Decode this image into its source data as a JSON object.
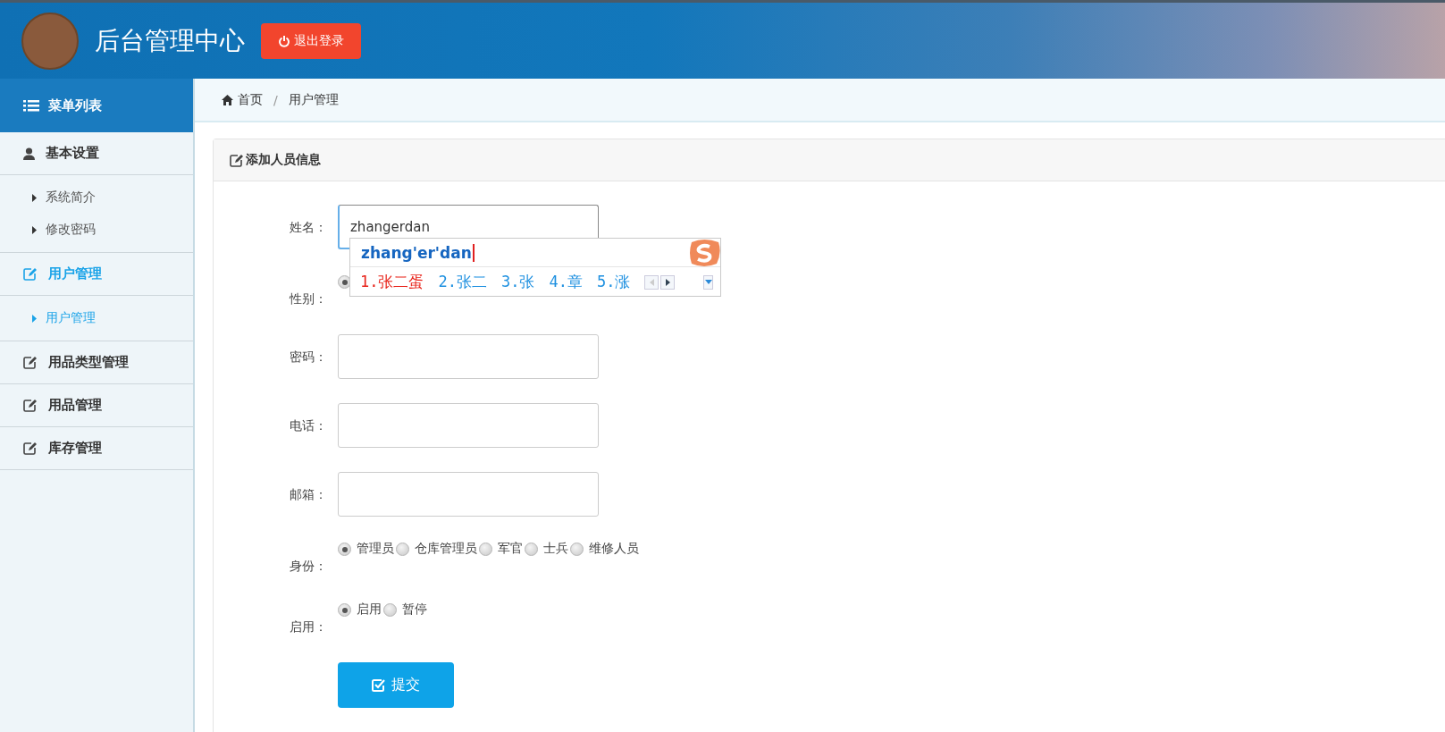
{
  "header": {
    "title": "后台管理中心",
    "logout_button": "退出登录"
  },
  "sidebar": {
    "title": "菜单列表",
    "groups": [
      {
        "label": "基本设置",
        "kind": "user",
        "selected": false,
        "items": [
          {
            "label": "系统简介",
            "selected": false
          },
          {
            "label": "修改密码",
            "selected": false
          }
        ]
      },
      {
        "label": "用户管理",
        "kind": "edit",
        "selected": true,
        "items": [
          {
            "label": "用户管理",
            "selected": true
          }
        ]
      },
      {
        "label": "用品类型管理",
        "kind": "edit",
        "selected": false
      },
      {
        "label": "用品管理",
        "kind": "edit",
        "selected": false
      },
      {
        "label": "库存管理",
        "kind": "edit",
        "selected": false
      }
    ]
  },
  "breadcrumb": {
    "separator": "/",
    "items": [
      {
        "label": "首页",
        "kind": "home"
      },
      {
        "label": "用户管理",
        "kind": "page"
      }
    ]
  },
  "form": {
    "title": "添加人员信息",
    "fields": [
      {
        "kind": "text",
        "label": "姓名：",
        "value": "zhangerdan"
      },
      {
        "kind": "radio",
        "label": "性别：",
        "options": [
          {
            "selected": true
          }
        ]
      },
      {
        "kind": "text",
        "label": "密码："
      },
      {
        "kind": "text",
        "label": "电话："
      },
      {
        "kind": "text",
        "label": "邮箱："
      },
      {
        "kind": "radio",
        "label": "身份：",
        "options": [
          {
            "label": "管理员",
            "selected": true
          },
          {
            "label": "仓库管理员",
            "selected": false
          },
          {
            "label": "军官",
            "selected": false
          },
          {
            "label": "士兵",
            "selected": false
          },
          {
            "label": "维修人员",
            "selected": false
          }
        ]
      },
      {
        "kind": "radio",
        "label": "启用：",
        "options": [
          {
            "label": "启用",
            "selected": true
          },
          {
            "label": "暂停",
            "selected": false
          }
        ]
      }
    ],
    "submit_button": "提交"
  },
  "ime": {
    "composition": "zhang'er'dan",
    "candidates": [
      {
        "label": "1.张二蛋",
        "selected": true
      },
      {
        "label": "2.张二",
        "selected": false
      },
      {
        "label": "3.张",
        "selected": false
      },
      {
        "label": "4.章",
        "selected": false
      },
      {
        "label": "5.涨",
        "selected": false
      }
    ]
  }
}
